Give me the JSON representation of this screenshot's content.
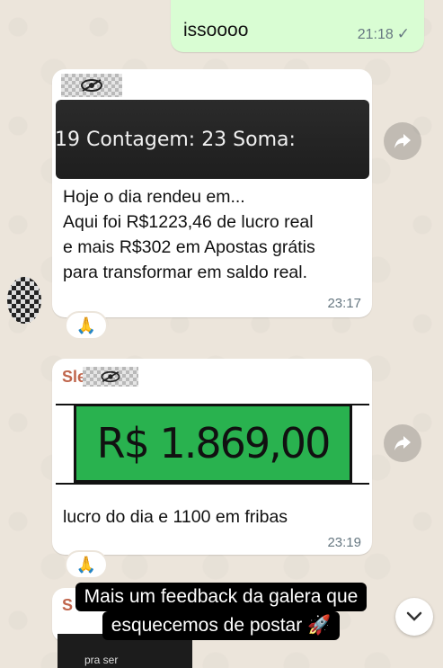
{
  "outgoing": {
    "text": "issoooo",
    "time": "21:18",
    "status_icon": "single-check-icon"
  },
  "message1": {
    "screenshot_text": ",19   Contagem: 23   Soma:",
    "lines": [
      "Hoje o dia rendeu em...",
      "Aqui foi R$1223,46 de lucro real",
      "e mais R$302 em Apostas grátis",
      "para transformar em saldo real."
    ],
    "time": "23:17",
    "reaction": "🙏"
  },
  "message2": {
    "sender": "Sle",
    "image_value": "R$ 1.869,00",
    "text": "lucro do dia e 1100 em fribas",
    "time": "23:19",
    "reaction": "🙏"
  },
  "message3": {
    "sender": "S",
    "thumb_text": "pra ser"
  },
  "caption": {
    "line1": "Mais um feedback da galera que",
    "line2": "esquecemos de postar 🚀"
  },
  "colors": {
    "bubble_out": "#d9fdd3",
    "sender": "#c0664d",
    "image_green": "#29b24f"
  }
}
